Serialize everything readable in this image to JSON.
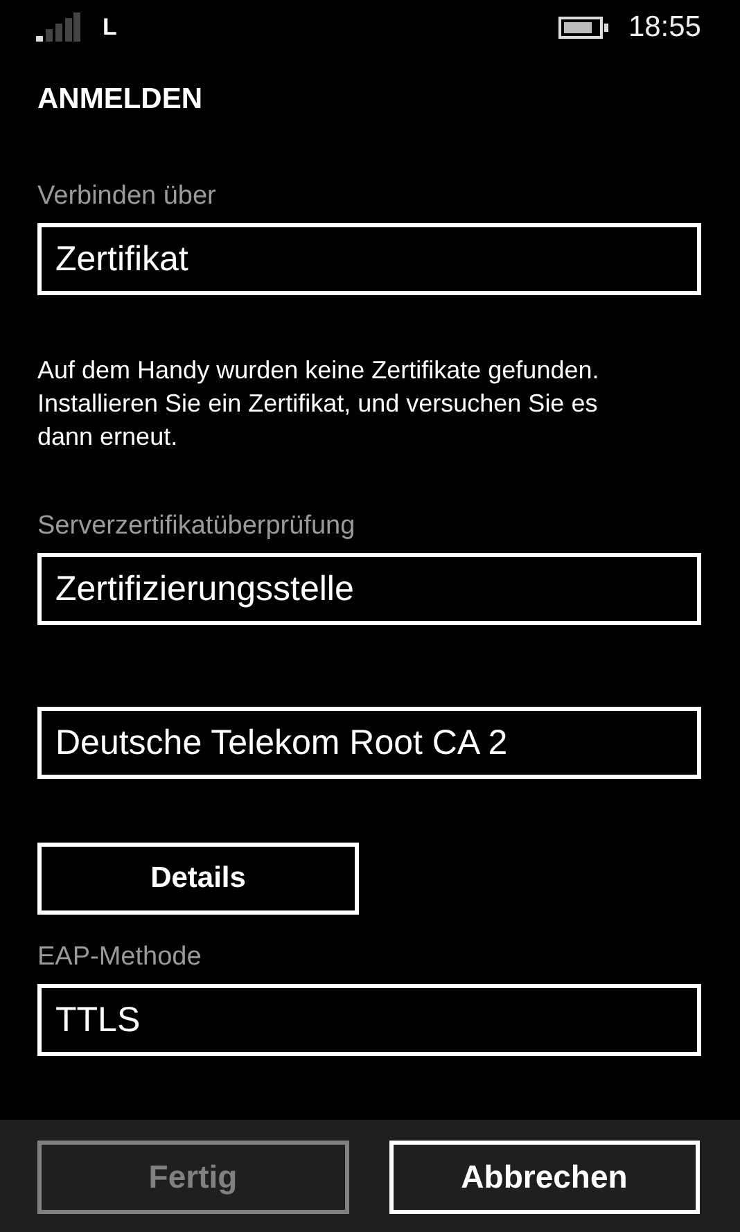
{
  "status_bar": {
    "network": "L",
    "time": "18:55"
  },
  "title": "ANMELDEN",
  "connect": {
    "label": "Verbinden über",
    "value": "Zertifikat"
  },
  "message": "Auf dem Handy wurden keine Zertifikate gefunden. Installieren Sie ein Zertifikat, und versuchen Sie es dann erneut.",
  "server_check": {
    "label": "Serverzertifikatüberprüfung",
    "value": "Zertifizierungsstelle"
  },
  "certificate": {
    "value": "Deutsche Telekom Root CA 2"
  },
  "details_button": "Details",
  "eap": {
    "label": "EAP-Methode",
    "value": "TTLS"
  },
  "app_bar": [
    {
      "label": "Fertig",
      "disabled": true
    },
    {
      "label": "Abbrechen",
      "disabled": false
    }
  ]
}
